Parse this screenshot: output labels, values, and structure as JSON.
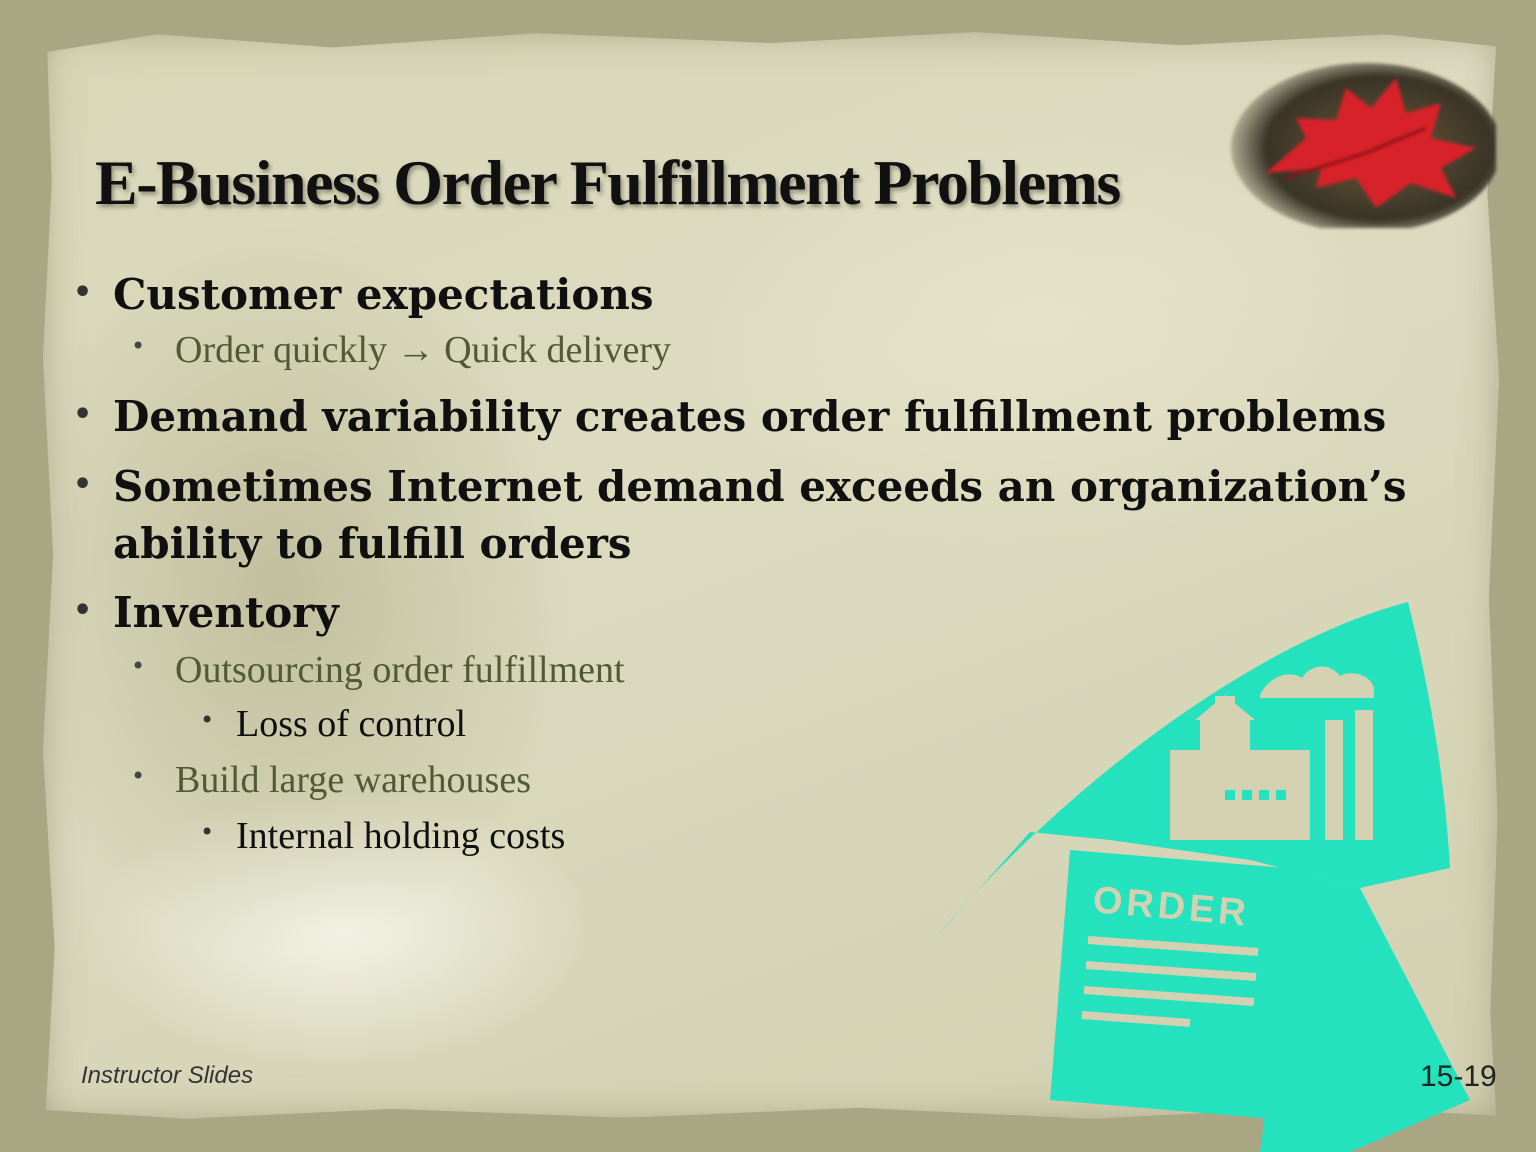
{
  "slide": {
    "title": "E-Business Order Fulfillment Problems",
    "bullets": [
      {
        "text": "Customer expectations"
      },
      {
        "text": "Order quickly → Quick delivery"
      },
      {
        "text": "Demand variability creates order fulfillment problems"
      },
      {
        "text": "Sometimes Internet demand exceeds an organization’s"
      },
      {
        "text": "ability to fulfill orders"
      },
      {
        "text": "Inventory"
      },
      {
        "text": "Outsourcing order fulfillment"
      },
      {
        "text": "Loss of control"
      },
      {
        "text": "Build large warehouses"
      },
      {
        "text": "Internal holding costs"
      }
    ],
    "bullet_glyph": "•",
    "footer_left": "Instructor Slides",
    "footer_right": "15-19",
    "clipart_label": "ORDER"
  },
  "colors": {
    "clipart_fill": "#24e2be",
    "level2_text": "#505a34",
    "leaf": "#d8222a"
  }
}
